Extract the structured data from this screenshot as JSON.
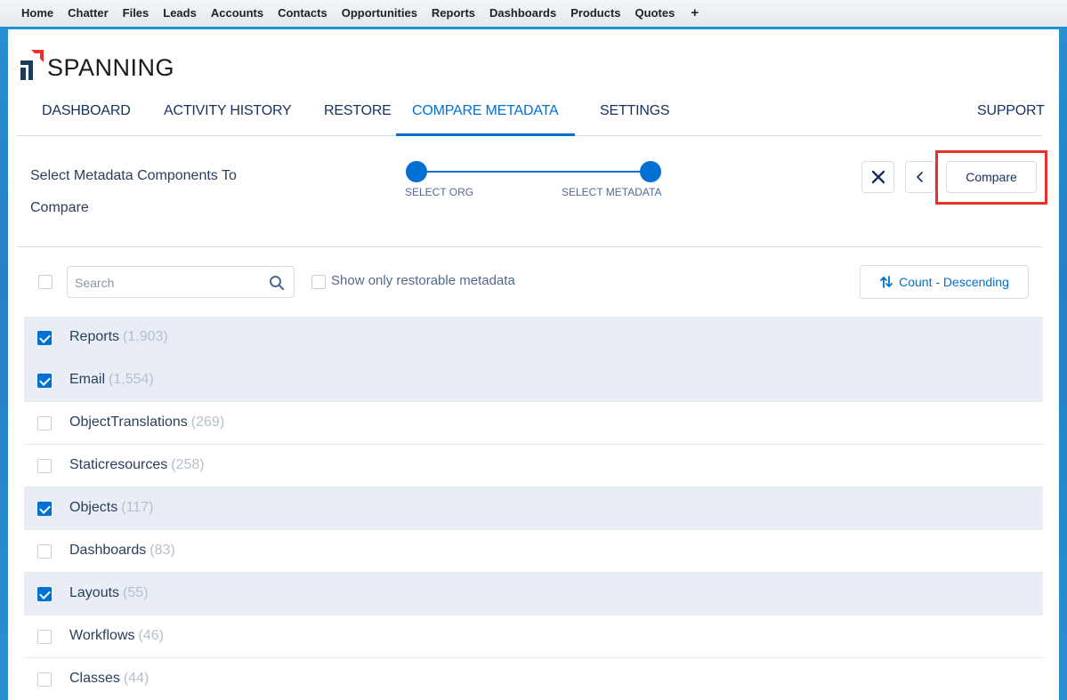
{
  "sf_tabs": [
    "Home",
    "Chatter",
    "Files",
    "Leads",
    "Accounts",
    "Contacts",
    "Opportunities",
    "Reports",
    "Dashboards",
    "Products",
    "Quotes"
  ],
  "sf_tab_add": "+",
  "brand": {
    "name": "SPANNING",
    "accent": "#e8312a",
    "dark": "#1a3d5c"
  },
  "app_nav": {
    "items": [
      "DASHBOARD",
      "ACTIVITY HISTORY",
      "RESTORE",
      "COMPARE METADATA",
      "SETTINGS"
    ],
    "active": "COMPARE METADATA",
    "support": "SUPPORT"
  },
  "step": {
    "title": "Select Metadata Components To Compare",
    "progress": [
      "SELECT ORG",
      "SELECT METADATA"
    ]
  },
  "actions": {
    "compare_label": "Compare",
    "close_icon": "close-icon",
    "back_icon": "chevron-left-icon"
  },
  "filters": {
    "search_placeholder": "Search",
    "restorable_label": "Show only restorable metadata",
    "sort_label": "Count - Descending"
  },
  "items": [
    {
      "name": "Reports",
      "count": "(1,903)",
      "checked": true
    },
    {
      "name": "Email",
      "count": "(1,554)",
      "checked": true
    },
    {
      "name": "ObjectTranslations",
      "count": "(269)",
      "checked": false
    },
    {
      "name": "Staticresources",
      "count": "(258)",
      "checked": false
    },
    {
      "name": "Objects",
      "count": "(117)",
      "checked": true
    },
    {
      "name": "Dashboards",
      "count": "(83)",
      "checked": false
    },
    {
      "name": "Layouts",
      "count": "(55)",
      "checked": true
    },
    {
      "name": "Workflows",
      "count": "(46)",
      "checked": false
    },
    {
      "name": "Classes",
      "count": "(44)",
      "checked": false
    }
  ],
  "colors": {
    "primary": "#0070d2",
    "highlight": "#e8312a",
    "selected_row": "#e9eef6"
  }
}
